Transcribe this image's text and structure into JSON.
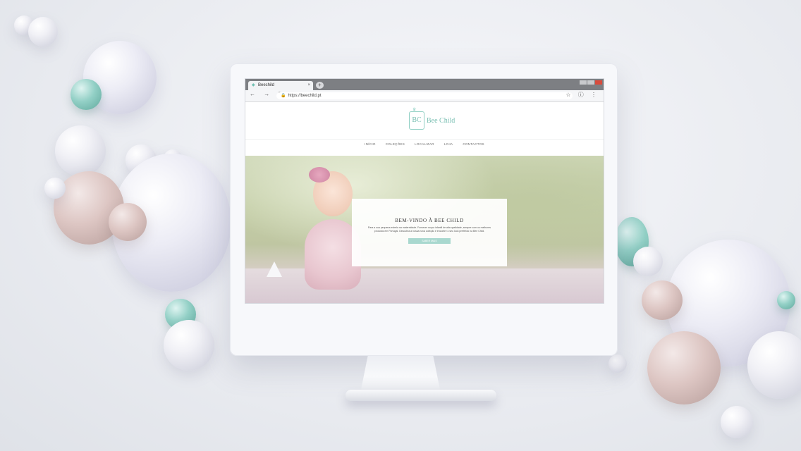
{
  "browser": {
    "tab_title": "Beechild",
    "tab_close": "×",
    "new_tab": "+",
    "url": "https://beechild.pt",
    "nav_icons": "← → ↻",
    "right_icons": "☆ ⓘ ⋮"
  },
  "site": {
    "logo_initials": "BC",
    "logo_name": "Bee Child",
    "menu": [
      "INÍCIO",
      "COLEÇÕES",
      "LOCALIZAR",
      "LOJA",
      "CONTACTOS"
    ],
    "hero": {
      "title": "BEM-VINDO À BEE CHILD",
      "text": "Para a sua pequena estrela na maternidade. Fornecer roupa infantil de alta qualidade, sempre com os melhores produtos em Portugal. Descubra a nossa nova coleção e encontre o seu look preferido na Bee Child.",
      "button": "SABER MAIS"
    }
  },
  "colors": {
    "brand_teal": "#79bfb2",
    "button_teal": "#a9d8cf"
  }
}
